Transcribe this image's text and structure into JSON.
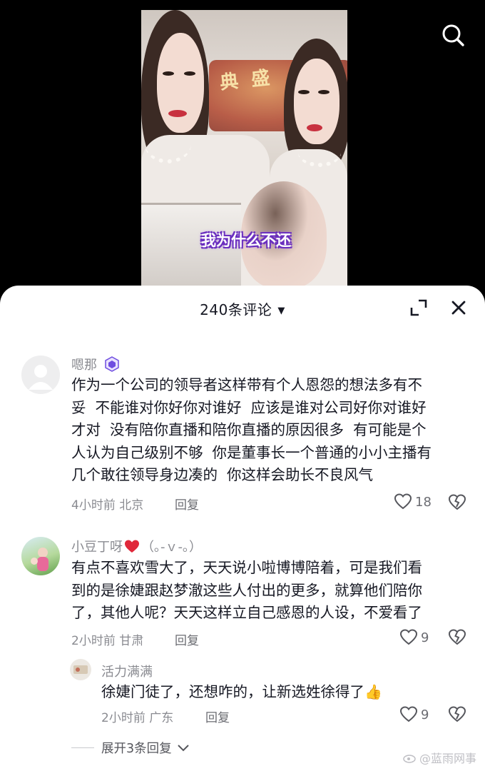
{
  "video": {
    "subtitle": "我为什么不还"
  },
  "header": {
    "comment_count_label": "240条评论"
  },
  "comments": [
    {
      "username": "嗯那",
      "text_lines": [
        "作为一个公司的领导者这样带有个人恩怨的想法多有不",
        "妥  不能谁对你好你对谁好  应该是谁对公司好你对谁好",
        "才对  没有陪你直播和陪你直播的原因很多  有可能是个",
        "人认为自己级别不够  你是董事长一个普通的小小主播有",
        "几个敢往领导身边凑的  你这样会助长不良风气"
      ],
      "meta": "4小时前 北京",
      "reply_label": "回复",
      "likes": "18"
    },
    {
      "username": "小豆丁呀",
      "username_suffix": "（｡-ｖ-｡）",
      "text_lines": [
        "有点不喜欢雪大了，天天说小啦博博陪着，可是我们看",
        "到的是徐婕跟赵梦澈这些人付出的更多，就算他们陪你",
        "了，其他人呢？天天这样立自己感恩的人设，不爱看了"
      ],
      "meta": "2小时前 甘肃",
      "reply_label": "回复",
      "likes": "9"
    }
  ],
  "reply": {
    "username": "活力满满",
    "text": "徐婕门徒了，还想咋的，让新选姓徐得了",
    "meta": "2小时前 广东",
    "reply_label": "回复",
    "likes": "9"
  },
  "expand_replies_label": "展开3条回复",
  "watermark": "@蓝雨网事",
  "colors": {
    "heart": "#e0283a",
    "badge": "#6f4de0",
    "text_primary": "#161823",
    "text_secondary": "#8a8b91"
  }
}
